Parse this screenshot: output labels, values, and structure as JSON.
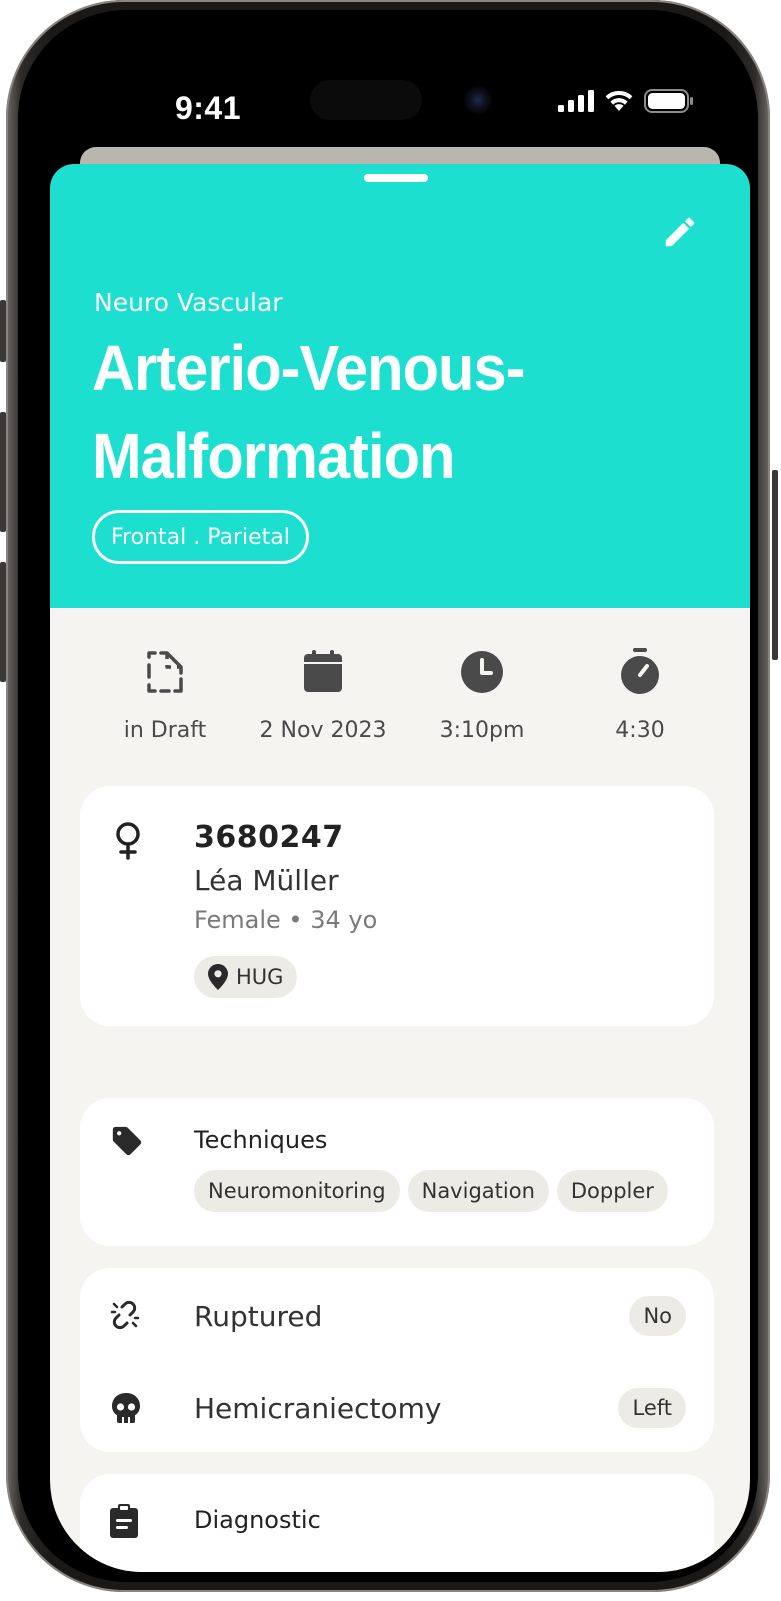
{
  "status_bar": {
    "time": "9:41"
  },
  "header": {
    "category": "Neuro Vascular",
    "title_line1": "Arterio-Venous-",
    "title_line2": "Malformation",
    "location_tag": "Frontal . Parietal",
    "accent_color": "#1ddfd0",
    "edit_icon": "pencil-icon"
  },
  "meta": {
    "status": {
      "icon": "draft-icon",
      "label": "in Draft"
    },
    "date": {
      "icon": "calendar-icon",
      "label": "2 Nov 2023"
    },
    "time": {
      "icon": "clock-icon",
      "label": "3:10pm"
    },
    "duration": {
      "icon": "stopwatch-icon",
      "label": "4:30"
    }
  },
  "patient": {
    "sex_icon": "female-icon",
    "id": "3680247",
    "name": "Léa Müller",
    "info": "Female • 34 yo",
    "hospital": "HUG"
  },
  "techniques": {
    "title": "Techniques",
    "items": [
      "Neuromonitoring",
      "Navigation",
      "Doppler"
    ]
  },
  "flags": {
    "ruptured": {
      "label": "Ruptured",
      "value": "No"
    },
    "hemicraniectomy": {
      "label": "Hemicraniectomy",
      "value": "Left"
    }
  },
  "diagnostic": {
    "title": "Diagnostic"
  }
}
